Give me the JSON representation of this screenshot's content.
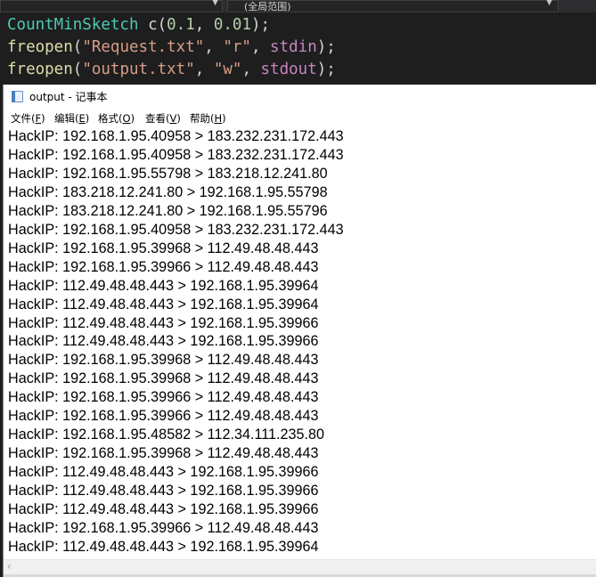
{
  "ide": {
    "left_dropdown": "",
    "right_dropdown": "(全局范围)",
    "code_lines": [
      [
        {
          "t": "CountMinSketch",
          "c": "type"
        },
        {
          "t": " ",
          "c": "id"
        },
        {
          "t": "c",
          "c": "id"
        },
        {
          "t": "(",
          "c": "id"
        },
        {
          "t": "0.1",
          "c": "num"
        },
        {
          "t": ", ",
          "c": "id"
        },
        {
          "t": "0.01",
          "c": "num"
        },
        {
          "t": ");",
          "c": "id"
        }
      ],
      [
        {
          "t": "freopen",
          "c": "fn"
        },
        {
          "t": "(",
          "c": "id"
        },
        {
          "t": "\"Request.txt\"",
          "c": "str"
        },
        {
          "t": ", ",
          "c": "id"
        },
        {
          "t": "\"r\"",
          "c": "str"
        },
        {
          "t": ", ",
          "c": "id"
        },
        {
          "t": "stdin",
          "c": "kw"
        },
        {
          "t": ");",
          "c": "id"
        }
      ],
      [
        {
          "t": "freopen",
          "c": "fn"
        },
        {
          "t": "(",
          "c": "id"
        },
        {
          "t": "\"output.txt\"",
          "c": "str"
        },
        {
          "t": ", ",
          "c": "id"
        },
        {
          "t": "\"w\"",
          "c": "str"
        },
        {
          "t": ", ",
          "c": "id"
        },
        {
          "t": "stdout",
          "c": "kw"
        },
        {
          "t": ");",
          "c": "id"
        }
      ]
    ]
  },
  "notepad": {
    "title": "output - 记事本",
    "menu": [
      {
        "label": "文件(",
        "key": "F",
        "end": ")"
      },
      {
        "label": "编辑(",
        "key": "E",
        "end": ")"
      },
      {
        "label": "格式(",
        "key": "O",
        "end": ")"
      },
      {
        "label": "查看(",
        "key": "V",
        "end": ")"
      },
      {
        "label": "帮助(",
        "key": "H",
        "end": ")"
      }
    ],
    "lines": [
      "HackIP: 192.168.1.95.40958 > 183.232.231.172.443",
      "HackIP: 192.168.1.95.40958 > 183.232.231.172.443",
      "HackIP: 192.168.1.95.55798 > 183.218.12.241.80",
      "HackIP: 183.218.12.241.80 > 192.168.1.95.55798",
      "HackIP: 183.218.12.241.80 > 192.168.1.95.55796",
      "HackIP: 192.168.1.95.40958 > 183.232.231.172.443",
      "HackIP: 192.168.1.95.39968 > 112.49.48.48.443",
      "HackIP: 192.168.1.95.39966 > 112.49.48.48.443",
      "HackIP: 112.49.48.48.443 > 192.168.1.95.39964",
      "HackIP: 112.49.48.48.443 > 192.168.1.95.39964",
      "HackIP: 112.49.48.48.443 > 192.168.1.95.39966",
      "HackIP: 112.49.48.48.443 > 192.168.1.95.39966",
      "HackIP: 192.168.1.95.39968 > 112.49.48.48.443",
      "HackIP: 192.168.1.95.39968 > 112.49.48.48.443",
      "HackIP: 192.168.1.95.39966 > 112.49.48.48.443",
      "HackIP: 192.168.1.95.39966 > 112.49.48.48.443",
      "HackIP: 192.168.1.95.48582 > 112.34.111.235.80",
      "HackIP: 192.168.1.95.39968 > 112.49.48.48.443",
      "HackIP: 112.49.48.48.443 > 192.168.1.95.39966",
      "HackIP: 112.49.48.48.443 > 192.168.1.95.39966",
      "HackIP: 112.49.48.48.443 > 192.168.1.95.39966",
      "HackIP: 192.168.1.95.39966 > 112.49.48.48.443",
      "HackIP: 112.49.48.48.443 > 192.168.1.95.39964"
    ],
    "scroll_left_glyph": "‹"
  },
  "colors": {
    "ide_bg": "#1e1e1e",
    "type": "#4ec9b0",
    "function": "#dcdcaa",
    "number": "#b5cea8",
    "string": "#d69d85",
    "keyword": "#c586c0"
  }
}
